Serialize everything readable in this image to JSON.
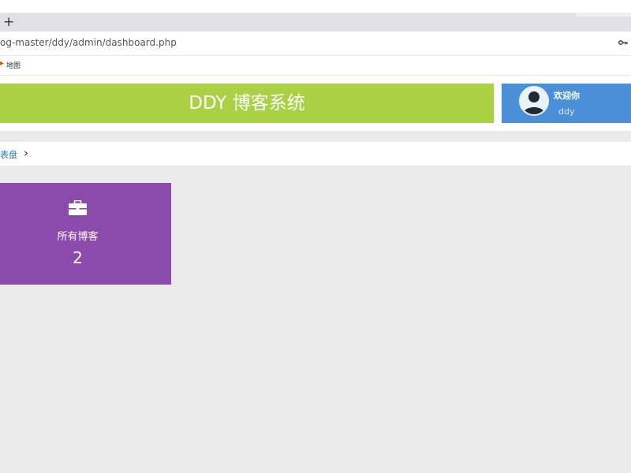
{
  "browser": {
    "new_tab_symbol": "+",
    "url": "og-master/ddy/admin/dashboard.php",
    "bookmark_label": "地图",
    "key_icon": "key-icon"
  },
  "header": {
    "brand_title": "DDY 博客系统",
    "brand_color": "#a9d143",
    "user_box_color": "#4a90d9",
    "welcome_text": "欢迎你",
    "username": "ddy"
  },
  "breadcrumb": {
    "label": "表盘",
    "separator": "›"
  },
  "stats": [
    {
      "label": "所有博客",
      "value": "2",
      "icon": "briefcase-icon",
      "color": "#8a4bac"
    }
  ]
}
